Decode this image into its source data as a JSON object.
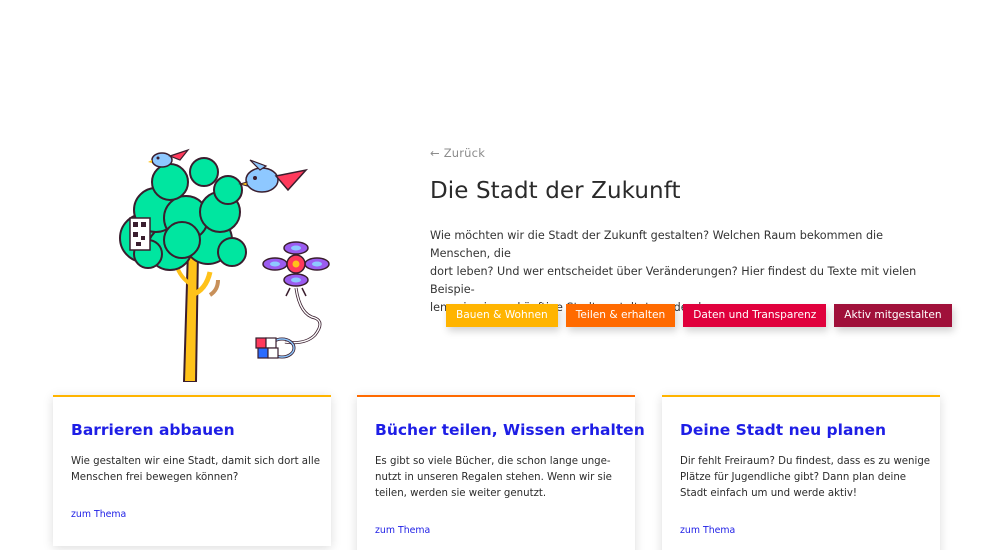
{
  "navigation": {
    "back_label": "← Zurück"
  },
  "page": {
    "title": "Die Stadt der Zukunft",
    "intro_lines": [
      "Wie möchten wir die Stadt der Zukunft gestalten? Welchen Raum bekommen die Menschen, die",
      "dort leben? Und wer entscheidet über Veränderungen? Hier findest du Texte mit vielen Beispie-",
      "len, wie eine zukünftige Stadt gestaltet werden kann."
    ]
  },
  "tags": [
    {
      "label": "Bauen & Wohnen",
      "color": "#ffb400"
    },
    {
      "label": "Teilen & erhalten",
      "color": "#ff6a00"
    },
    {
      "label": "Daten und Transparenz",
      "color": "#e0003c"
    },
    {
      "label": "Aktiv mitgestalten",
      "color": "#a0103a"
    }
  ],
  "cards": [
    {
      "title": "Barrieren abbauen",
      "text_lines": [
        "Wie gestalten wir eine Stadt, damit sich dort alle",
        "Menschen frei bewegen können?"
      ],
      "link_label": "zum Thema",
      "accent_color": "#ffb400"
    },
    {
      "title": "Bücher teilen, Wissen erhalten",
      "text_lines": [
        "Es gibt so viele Bücher, die schon lange unge-",
        "nutzt in unseren Regalen stehen. Wenn wir sie",
        "teilen, werden sie weiter genutzt."
      ],
      "link_label": "zum Thema",
      "accent_color": "#ff6a00"
    },
    {
      "title": "Deine Stadt neu planen",
      "text_lines": [
        "Dir fehlt Freiraum? Du findest, dass es zu wenige",
        "Plätze für Jugendliche gibt? Dann plan deine",
        "Stadt einfach um und werde aktiv!"
      ],
      "link_label": "zum Thema",
      "accent_color": "#ffb400"
    }
  ],
  "illustration": {
    "icons": [
      "tree-icon",
      "bird-icon",
      "drone-icon",
      "qr-code-icon",
      "cube-icon"
    ],
    "colors": {
      "foliage": "#00e6a0",
      "trunk": "#ffc21a",
      "drone": "#9b5cf0",
      "bird": "#8ec8ff"
    }
  }
}
